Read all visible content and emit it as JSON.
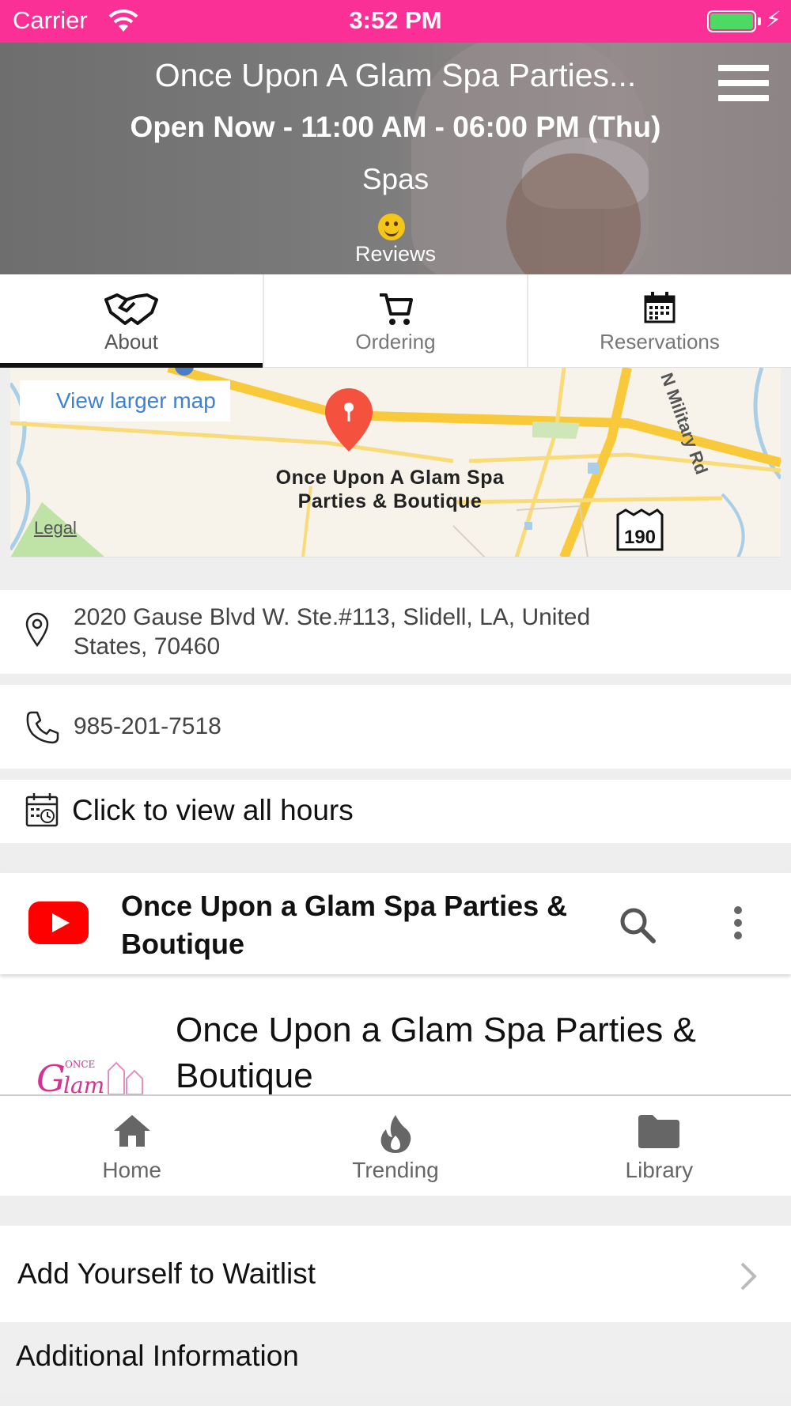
{
  "status_bar": {
    "carrier": "Carrier",
    "time": "3:52 PM",
    "battery_level": 1.0,
    "colors": {
      "bar": "#fb3096",
      "battery": "#4cd964"
    }
  },
  "header": {
    "title": "Once Upon A Glam Spa Parties...",
    "hours": "Open Now - 11:00 AM - 06:00 PM (Thu)",
    "category": "Spas",
    "reviews_label": "Reviews",
    "menu_icon": "hamburger-menu-icon"
  },
  "tabs": [
    {
      "label": "About",
      "icon": "handshake-icon",
      "active": true
    },
    {
      "label": "Ordering",
      "icon": "cart-icon",
      "active": false
    },
    {
      "label": "Reservations",
      "icon": "calendar-icon",
      "active": false
    }
  ],
  "map": {
    "view_larger_label": "View larger map",
    "place_label_line1": "Once Upon A Glam Spa",
    "place_label_line2": "Parties & Boutique",
    "road_label": "N Military Rd",
    "highway_shield": "190",
    "legal_label": "Legal"
  },
  "contact": {
    "address": "2020 Gause Blvd W. Ste.#113, Slidell, LA, United States, 70460",
    "phone": "985-201-7518",
    "hours_link": "Click to view all hours"
  },
  "youtube": {
    "channel_header": "Once Upon a Glam Spa Parties & Boutique",
    "channel_title": "Once Upon a Glam Spa Parties & Boutique",
    "nav": [
      {
        "label": "Home",
        "icon": "home-icon"
      },
      {
        "label": "Trending",
        "icon": "flame-icon"
      },
      {
        "label": "Library",
        "icon": "folder-icon"
      }
    ]
  },
  "waitlist": {
    "label": "Add Yourself to Waitlist"
  },
  "additional_info": {
    "label": "Additional Information"
  }
}
